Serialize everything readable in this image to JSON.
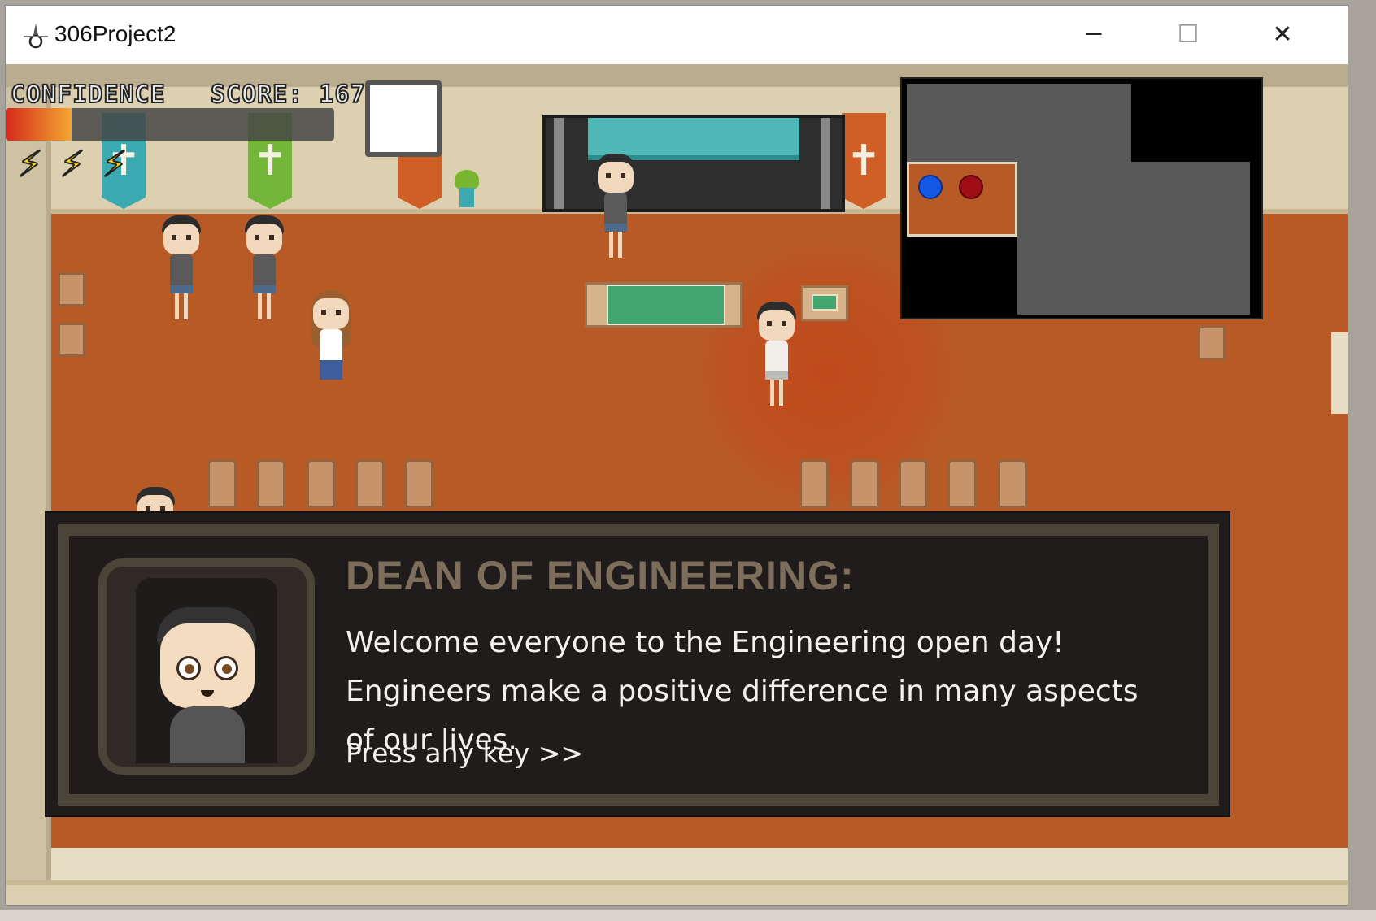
{
  "window": {
    "title": "306Project2",
    "icon": "hololive-app-icon",
    "controls": {
      "minimize": "─",
      "maximize": "☐",
      "close": "✕"
    }
  },
  "hud": {
    "confidence_label": "CONFIDENCE",
    "score_label": "SCORE: 167",
    "confidence_level": 0.2,
    "energy_bolts": 3,
    "bolt_glyph": "⚡",
    "item_slot": "empty"
  },
  "decor": {
    "banner_glyph": "✝",
    "colors": {
      "floor": "#b85a26",
      "banner_teal": "#3aa9b0",
      "banner_green": "#74b63a",
      "banner_orange": "#cf5f25"
    }
  },
  "minimap": {
    "player_marker_color": "#1557e6",
    "npc_marker_color": "#a10d14"
  },
  "dialog": {
    "speaker": "DEAN OF ENGINEERING:",
    "text": "Welcome everyone to the Engineering open day! Engineers make a positive difference in many aspects of our lives.",
    "prompt": "Press any key >>"
  }
}
